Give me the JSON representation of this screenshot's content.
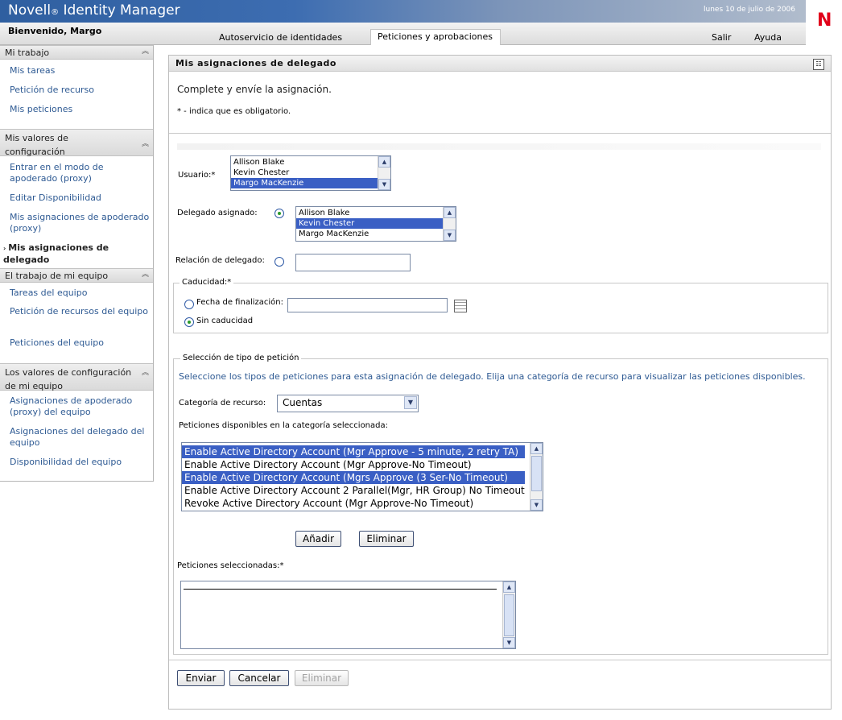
{
  "header": {
    "brand": "Novell",
    "brand_reg": "®",
    "product": "Identity Manager",
    "date": "lunes 10 de julio de 2006",
    "logo_letter": "N",
    "welcome": "Bienvenido, Margo",
    "tabs": [
      {
        "label": "Autoservicio de identidades",
        "active": false
      },
      {
        "label": "Peticiones y aprobaciones",
        "active": true
      }
    ],
    "links": {
      "logout": "Salir",
      "help": "Ayuda"
    }
  },
  "sidebar": {
    "sections": [
      {
        "title": "Mi trabajo",
        "items": [
          "Mis tareas",
          "Petición de recurso",
          "Mis peticiones"
        ]
      },
      {
        "title": "Mis valores de configuración",
        "items": [
          "Entrar en el modo de apoderado (proxy)",
          "Editar Disponibilidad",
          "Mis asignaciones de apoderado (proxy)",
          "Mis asignaciones de delegado"
        ]
      },
      {
        "title": "El trabajo de mi equipo",
        "items": [
          "Tareas del equipo",
          "Petición de recursos del equipo",
          "Peticiones del equipo"
        ]
      },
      {
        "title": "Los valores de configuración de mi equipo",
        "items": [
          "Asignaciones de apoderado (proxy) del equipo",
          "Asignaciones del delegado del equipo",
          "Disponibilidad del equipo"
        ]
      }
    ],
    "current_marker": "›"
  },
  "main": {
    "title": "Mis asignaciones de delegado",
    "intro": "Complete y envíe la asignación.",
    "required_note": "* - indica que es obligatorio.",
    "user": {
      "label": "Usuario:*",
      "options": [
        "Allison Blake",
        "Kevin Chester",
        "Margo MacKenzie"
      ],
      "selected": "Margo MacKenzie"
    },
    "delegate": {
      "label": "Delegado asignado:",
      "options": [
        "Allison Blake",
        "Kevin Chester",
        "Margo MacKenzie"
      ],
      "selected": "Kevin Chester",
      "radio_selected": true
    },
    "relation": {
      "label": "Relación de delegado:",
      "value": ""
    },
    "expiry": {
      "legend": "Caducidad:*",
      "end_date_label": "Fecha de finalización:",
      "end_date_value": "",
      "no_expiry_label": "Sin caducidad",
      "selected": "no_expiry"
    },
    "request_type": {
      "legend": "Selección de tipo de petición",
      "help": "Seleccione los tipos de peticiones para esta asignación de delegado. Elija una categoría de recurso para visualizar las peticiones disponibles.",
      "category_label": "Categoría de recurso:",
      "category_value": "Cuentas",
      "available_label": "Peticiones disponibles en la categoría seleccionada:",
      "available": [
        {
          "text": "Enable Active Directory Account (Mgr Approve - 5 minute, 2 retry TA)",
          "selected": true
        },
        {
          "text": "Enable Active Directory Account (Mgr Approve-No Timeout)",
          "selected": false
        },
        {
          "text": "Enable Active Directory Account (Mgrs Approve (3 Ser-No Timeout)",
          "selected": true
        },
        {
          "text": "Enable Active Directory Account 2 Parallel(Mgr, HR Group) No Timeout",
          "selected": false
        },
        {
          "text": "Revoke Active Directory Account (Mgr Approve-No Timeout)",
          "selected": false
        }
      ],
      "add_label": "Añadir",
      "remove_label": "Eliminar",
      "selected_label": "Peticiones seleccionadas:*"
    },
    "footer": {
      "submit": "Enviar",
      "cancel": "Cancelar",
      "delete": "Eliminar"
    }
  }
}
